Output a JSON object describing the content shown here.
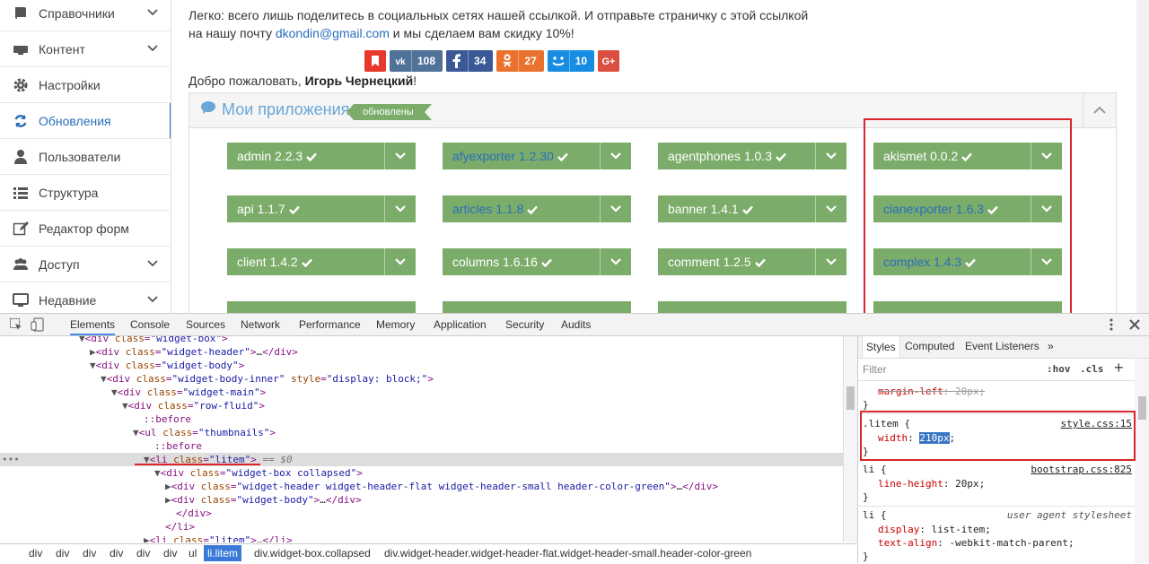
{
  "sidebar": {
    "items": [
      {
        "label": "Справочники",
        "icon": "book-icon",
        "chevron": true
      },
      {
        "label": "Контент",
        "icon": "keyboard-icon",
        "chevron": true
      },
      {
        "label": "Настройки",
        "icon": "gear-icon",
        "chevron": false
      },
      {
        "label": "Обновления",
        "icon": "refresh-icon",
        "chevron": false,
        "active": true
      },
      {
        "label": "Пользователи",
        "icon": "user-icon",
        "chevron": false
      },
      {
        "label": "Структура",
        "icon": "list-icon",
        "chevron": false
      },
      {
        "label": "Редактор форм",
        "icon": "edit-icon",
        "chevron": false
      },
      {
        "label": "Доступ",
        "icon": "users-icon",
        "chevron": true
      },
      {
        "label": "Недавние",
        "icon": "desktop-icon",
        "chevron": true
      }
    ]
  },
  "intro": {
    "line1": "Легко: всего лишь поделитесь в социальных сетях нашей ссылкой. И отправьте страничку с этой ссылкой",
    "line2_before": "на нашу почту ",
    "email": "dkondin@gmail.com",
    "line2_after": " и мы сделаем вам скидку 10%!"
  },
  "share": {
    "buttons": [
      {
        "network": "bookmark",
        "icon": "bookmark-icon",
        "count": "",
        "color": "#e8372c"
      },
      {
        "network": "vk",
        "icon": "vk-icon",
        "count": "108",
        "color": "#507299"
      },
      {
        "network": "facebook",
        "icon": "facebook-icon",
        "count": "34",
        "color": "#3b5998"
      },
      {
        "network": "odnoklassniki",
        "icon": "odnoklassniki-icon",
        "count": "27",
        "color": "#eb722e"
      },
      {
        "network": "moimir",
        "icon": "moimir-icon",
        "count": "10",
        "color": "#168de2"
      },
      {
        "network": "googleplus",
        "icon": "googleplus-icon",
        "count": "",
        "color": "#dc4e41"
      }
    ]
  },
  "welcome": {
    "prefix": "Добро пожаловать, ",
    "name": "Игорь Чернецкий",
    "suffix": "!"
  },
  "widget": {
    "title": "Мои приложения",
    "badge": "обновлены",
    "modules": [
      {
        "name": "admin 2.2.3",
        "link": false
      },
      {
        "name": "afyexporter 1.2.30",
        "link": true
      },
      {
        "name": "agentphones 1.0.3",
        "link": false
      },
      {
        "name": "akismet 0.0.2",
        "link": false
      },
      {
        "name": "api 1.1.7",
        "link": false
      },
      {
        "name": "articles 1.1.8",
        "link": true
      },
      {
        "name": "banner 1.4.1",
        "link": false
      },
      {
        "name": "cianexporter 1.6.3",
        "link": true
      },
      {
        "name": "client 1.4.2",
        "link": false
      },
      {
        "name": "columns 1.6.16",
        "link": false
      },
      {
        "name": "comment 1.2.5",
        "link": false
      },
      {
        "name": "complex 1.4.3",
        "link": true
      }
    ],
    "accent": "#7cac6a"
  },
  "devtools": {
    "tabs": [
      "Elements",
      "Console",
      "Sources",
      "Network",
      "Performance",
      "Memory",
      "Application",
      "Security",
      "Audits"
    ],
    "active_tab": "Elements",
    "dom": [
      {
        "indent": 0,
        "tri": "▼",
        "html": "<div class=\"widget-box\">"
      },
      {
        "indent": 1,
        "tri": "▶",
        "html": "<div class=\"widget-header\">…</div>"
      },
      {
        "indent": 1,
        "tri": "▼",
        "html": "<div class=\"widget-body\">"
      },
      {
        "indent": 2,
        "tri": "▼",
        "html": "<div class=\"widget-body-inner\" style=\"display: block;\">"
      },
      {
        "indent": 3,
        "tri": "▼",
        "html": "<div class=\"widget-main\">"
      },
      {
        "indent": 4,
        "tri": "▼",
        "html": "<div class=\"row-fluid\">"
      },
      {
        "indent": 5,
        "tri": "",
        "html": "::before"
      },
      {
        "indent": 5,
        "tri": "▼",
        "html": "<ul class=\"thumbnails\">"
      },
      {
        "indent": 6,
        "tri": "",
        "html": "::before"
      },
      {
        "indent": 6,
        "tri": "▼",
        "html": "<li class=\"litem\">",
        "note": "== $0",
        "selected": true
      },
      {
        "indent": 7,
        "tri": "▼",
        "html": "<div class=\"widget-box collapsed\">"
      },
      {
        "indent": 8,
        "tri": "▶",
        "html": "<div class=\"widget-header widget-header-flat widget-header-small header-color-green\">…</div>"
      },
      {
        "indent": 8,
        "tri": "▶",
        "html": "<div class=\"widget-body\">…</div>"
      },
      {
        "indent": 8,
        "tri": "",
        "html": "</div>"
      },
      {
        "indent": 7,
        "tri": "",
        "html": "</li>"
      },
      {
        "indent": 6,
        "tri": "▶",
        "html": "<li class=\"litem\">…</li>"
      }
    ],
    "breadcrumb": [
      "div",
      "div",
      "div",
      "div",
      "div",
      "div",
      "ul",
      "li.litem",
      "div.widget-box.collapsed",
      "div.widget-header.widget-header-flat.widget-header-small.header-color-green"
    ],
    "breadcrumb_active": "li.litem",
    "styles": {
      "tabs": [
        "Styles",
        "Computed",
        "Event Listeners",
        "»"
      ],
      "filter_placeholder": "Filter",
      "hov": ":hov",
      "cls": ".cls",
      "add": "+",
      "rules": {
        "prev_prop": "margin-left",
        "prev_value": "20px",
        "litem_selector": ".litem {",
        "litem_source": "style.css:15",
        "litem_prop": "width",
        "litem_value": "210px",
        "li_selector": "li {",
        "li_source": "bootstrap.css:825",
        "li_prop": "line-height",
        "li_value": "20px",
        "ua_selector": "li {",
        "ua_source": "user agent stylesheet",
        "ua_prop1": "display",
        "ua_value1": "list-item",
        "ua_prop2": "text-align",
        "ua_value2": "-webkit-match-parent",
        "close": "}"
      }
    }
  }
}
